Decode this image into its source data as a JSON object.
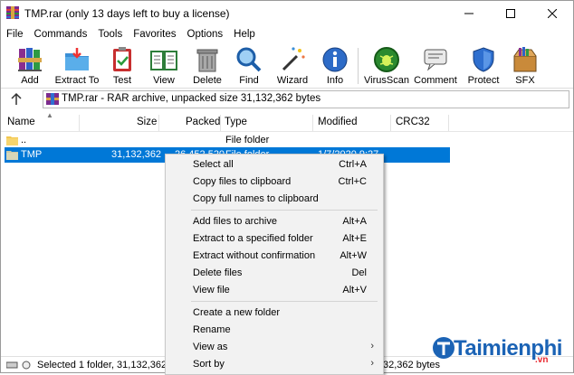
{
  "window": {
    "title": "TMP.rar (only 13 days left to buy a license)",
    "controls": {
      "minimize": "minimize",
      "maximize": "maximize",
      "close": "close"
    }
  },
  "menu": [
    "File",
    "Commands",
    "Tools",
    "Favorites",
    "Options",
    "Help"
  ],
  "toolbar": {
    "add": "Add",
    "extract_to": "Extract To",
    "test": "Test",
    "view": "View",
    "delete": "Delete",
    "find": "Find",
    "wizard": "Wizard",
    "info": "Info",
    "virusscan": "VirusScan",
    "comment": "Comment",
    "protect": "Protect",
    "sfx": "SFX"
  },
  "address": {
    "text": "TMP.rar - RAR archive, unpacked size 31,132,362 bytes"
  },
  "columns": {
    "name": "Name",
    "size": "Size",
    "packed": "Packed",
    "type": "Type",
    "modified": "Modified",
    "crc32": "CRC32"
  },
  "rows": [
    {
      "name": "..",
      "size": "",
      "packed": "",
      "type": "File folder",
      "modified": "",
      "crc": ""
    },
    {
      "name": "TMP",
      "size": "31,132,362",
      "packed": "26,452,520",
      "type": "File folder",
      "modified": "1/7/2020 9:27",
      "crc": ""
    }
  ],
  "context_menu": [
    {
      "label": "Select all",
      "shortcut": "Ctrl+A"
    },
    {
      "label": "Copy files to clipboard",
      "shortcut": "Ctrl+C"
    },
    {
      "label": "Copy full names to clipboard",
      "shortcut": ""
    },
    {
      "label": "Add files to archive",
      "shortcut": "Alt+A"
    },
    {
      "label": "Extract to a specified folder",
      "shortcut": "Alt+E"
    },
    {
      "label": "Extract without confirmation",
      "shortcut": "Alt+W"
    },
    {
      "label": "Delete files",
      "shortcut": "Del"
    },
    {
      "label": "View file",
      "shortcut": "Alt+V"
    },
    {
      "label": "Create a new folder",
      "shortcut": ""
    },
    {
      "label": "Rename",
      "shortcut": ""
    },
    {
      "label": "View as",
      "shortcut": "",
      "submenu": "›"
    },
    {
      "label": "Sort by",
      "shortcut": "",
      "submenu": "›"
    }
  ],
  "status": {
    "left": "Selected 1 folder, 31,132,362 byte",
    "right": "32,362 bytes"
  },
  "watermark": {
    "brand": "Taimienphi",
    "tld": ".vn"
  },
  "colors": {
    "selection": "#0078d7",
    "watermark": "#1b63b5",
    "watermark_vn": "#e8262d"
  }
}
